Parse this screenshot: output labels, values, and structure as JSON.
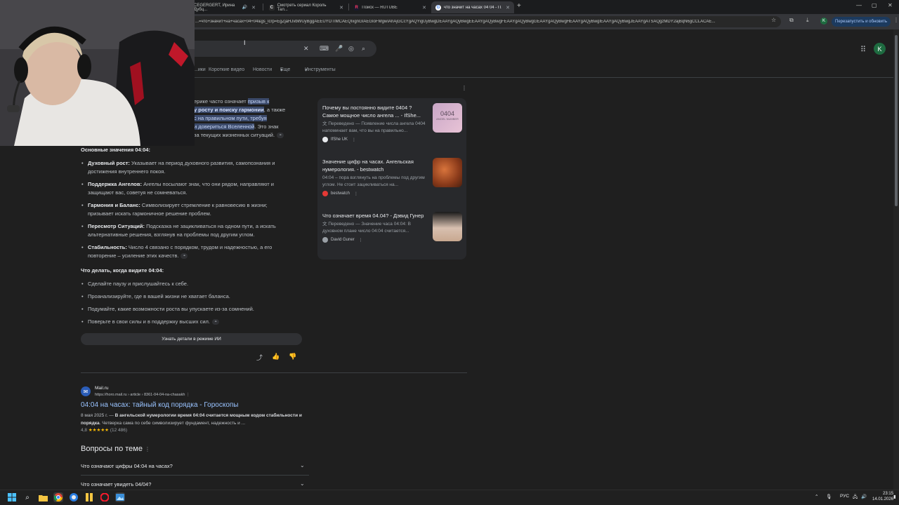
{
  "browser": {
    "tabs": [
      {
        "label": "CEGERGERT, Ирина Дубц..."
      },
      {
        "label": "Смотреть сериал Король Тал..."
      },
      {
        "label": "Поиск — RUTUBE"
      },
      {
        "label": "что значит на часах 04 04 - П..."
      }
    ],
    "url": "...=что+значит+на+часах+04+04&gs_lcrp=EgZjaHJvbWUyBggAEEUYOTIMCAEQIxgnGIAEGIoFMgwIAhAjGCcYgAQYigUyBwgDEAAYgAQyBwgEEAAYgAQyBwgFEAAYgAQyBwgGEAAYgAQyBwgHEAAYgAQyBwgIEAAYgAQyBwgJEAAYgATSAQgzMDY2ajBqN6gCCLACAE...",
    "relaunch_label": "Перезапустить и обновить",
    "profile_initial": "K",
    "icons": [
      "bookmark-star-icon",
      "extensions-icon",
      "download-icon",
      "menu-icon"
    ]
  },
  "google": {
    "nav_tabs": [
      "...ики",
      "Короткие видео",
      "Новости",
      "Еще",
      "Инструменты"
    ],
    "avatar_initial": "K"
  },
  "ai_overview": {
    "intro_lines": [
      {
        "pre": "ерике часто означает ",
        "hl": "призыв к"
      },
      {
        "pre": "",
        "hl_bold": "у росту и поиску гармонии",
        "post": ", а также"
      },
      {
        "pre": "",
        "hl": "с на правильном пути, требуя"
      },
      {
        "pre": "",
        "hl": "и довериться Вселенной",
        "post": ". Это знак"
      },
      {
        "pre": "за текущих жизненных ситуаций."
      }
    ],
    "heading_meanings": "Основные значения 04:04:",
    "meanings": [
      {
        "term": "Духовный рост:",
        "line1": " Указывает на период духовного развития, самопознания и",
        "line2": "достижения внутреннего покоя."
      },
      {
        "term": "Поддержка Ангелов:",
        "line1": " Ангелы посылают знак, что они рядом, направляют и",
        "line2": "защищают вас, советуя не сомневаться."
      },
      {
        "term": "Гармония и Баланс:",
        "line1": " Символизирует стремление к равновесию в жизни;",
        "line2": "призывает искать гармоничное решение проблем."
      },
      {
        "term": "Пересмотр Ситуаций:",
        "line1": " Подсказка не зацикливаться на одном пути, а искать",
        "line2": "альтернативные решения, взглянув на проблемы под другим углом."
      },
      {
        "term": "Стабильность:",
        "line1": " Число 4 связано с порядком, трудом и надежностью, а его",
        "line2": "повторение – усиление этих качеств."
      }
    ],
    "heading_actions": "Что делать, когда видите 04:04:",
    "actions": [
      "Сделайте паузу и прислушайтесь к себе.",
      "Проанализируйте, где в вашей жизни не хватает баланса.",
      "Подумайте, какие возможности роста вы упускаете из-за сомнений.",
      "Поверьте в свои силы и в поддержку высших сил."
    ],
    "ai_mode_button": "Узнать детали в режиме ИИ"
  },
  "sources": [
    {
      "title": "Почему вы постоянно видите 0404 ? Самое мощное число ангела ... - IfShe...",
      "snippet": "Переведено — Появление числа ангела 0404 напоминает вам, что вы на правильно...",
      "site": "IfShe UK",
      "thumb_text": "0404",
      "thumb_sub": "ANGEL NUMBER"
    },
    {
      "title": "Значение цифр на часах. Ангельская нумерология. - bestwatch",
      "snippet": "04:04 – пора взглянуть на проблемы под другим углом. Не стоит зацикливаться на...",
      "site": "bestwatch"
    },
    {
      "title": "Что означает время 04.04? - Дэвид Гунер",
      "snippet": "Переведено — Значение часа 04:04: В духовном плане число 04:04 считается...",
      "site": "David Guner"
    }
  ],
  "result": {
    "site": "Mail.ru",
    "url": "https://horo.mail.ru › article › 8361-04-04-na-chasakh",
    "title": "04:04 на часах: тайный код порядка - Гороскопы",
    "date": "8 мая 2025 г. — ",
    "snippet_bold": "В ангельской нумерологии время 04:04 считается мощным кодом стабильности и порядка",
    "snippet_rest": ". Четверка сама по себе символизирует фундамент, надежность и ...",
    "rating": "4,8",
    "stars": "★★★★★",
    "reviews": "(12 486)"
  },
  "paa": {
    "title": "Вопросы по теме",
    "questions": [
      "Что означают цифры 04:04 на часах?",
      "Что означает увидеть 04/04?"
    ]
  },
  "taskbar": {
    "lang": "РУС",
    "time": "23:15",
    "date": "14.01.2026"
  }
}
